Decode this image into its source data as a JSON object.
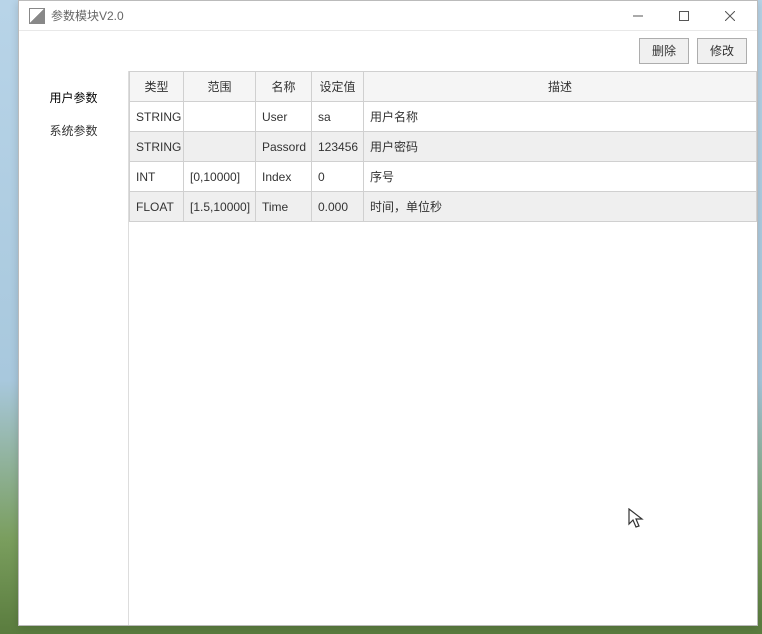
{
  "window": {
    "title": "参数模块V2.0"
  },
  "toolbar": {
    "delete_label": "删除",
    "edit_label": "修改"
  },
  "sidebar": {
    "items": [
      {
        "label": "用户参数"
      },
      {
        "label": "系统参数"
      }
    ]
  },
  "table": {
    "headers": {
      "type": "类型",
      "range": "范围",
      "name": "名称",
      "value": "设定值",
      "desc": "描述"
    },
    "rows": [
      {
        "type": "STRING",
        "range": "",
        "name": "User",
        "value": "sa",
        "desc": "用户名称"
      },
      {
        "type": "STRING",
        "range": "",
        "name": "Passord",
        "value": "123456",
        "desc": "用户密码"
      },
      {
        "type": "INT",
        "range": "[0,10000]",
        "name": "Index",
        "value": "0",
        "desc": "序号"
      },
      {
        "type": "FLOAT",
        "range": "[1.5,10000]",
        "name": "Time",
        "value": "0.000",
        "desc": "时间，单位秒"
      }
    ]
  }
}
